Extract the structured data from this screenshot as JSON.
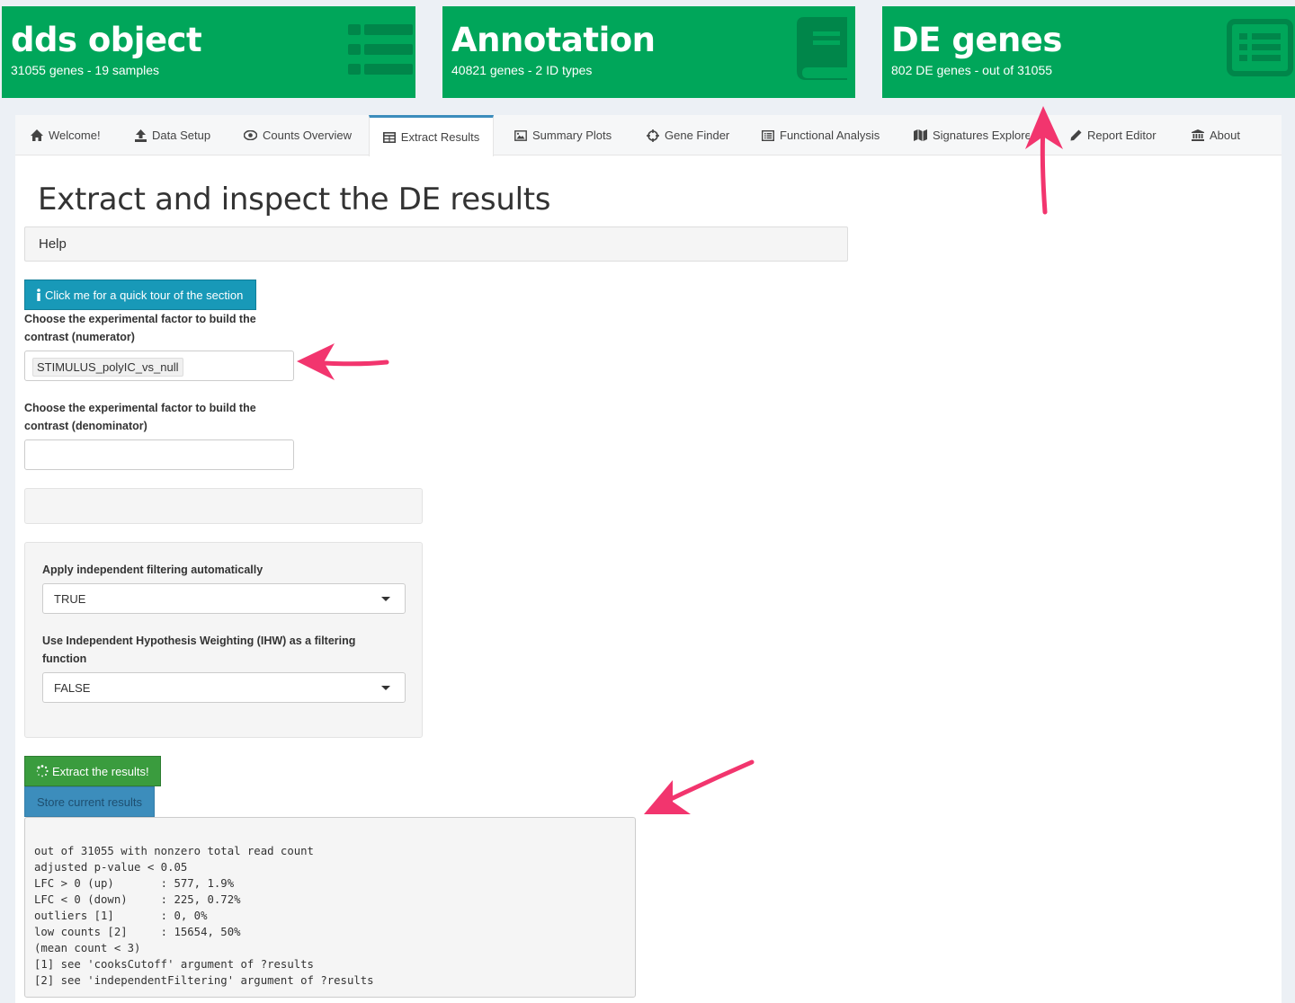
{
  "value_boxes": [
    {
      "title": "dds object",
      "subtitle": "31055 genes - 19 samples",
      "icon": "list-icon"
    },
    {
      "title": "Annotation",
      "subtitle": "40821 genes - 2 ID types",
      "icon": "book-icon"
    },
    {
      "title": "DE genes",
      "subtitle": "802 DE genes - out of 31055",
      "icon": "list-alt-icon"
    }
  ],
  "tabs": [
    {
      "label": "Welcome!",
      "icon": "home-icon"
    },
    {
      "label": "Data Setup",
      "icon": "upload-icon"
    },
    {
      "label": "Counts Overview",
      "icon": "eye-icon"
    },
    {
      "label": "Extract Results",
      "icon": "table-icon",
      "active": true
    },
    {
      "label": "Summary Plots",
      "icon": "image-icon"
    },
    {
      "label": "Gene Finder",
      "icon": "crosshairs-icon"
    },
    {
      "label": "Functional Analysis",
      "icon": "list-alt-icon"
    },
    {
      "label": "Signatures Explorer",
      "icon": "map-icon"
    },
    {
      "label": "Report Editor",
      "icon": "pencil-icon"
    },
    {
      "label": "About",
      "icon": "institution-icon"
    }
  ],
  "main": {
    "heading": "Extract and inspect the DE results",
    "help_label": "Help",
    "tour_button": "Click me for a quick tour of the section",
    "numerator_label": "Choose the experimental factor to build the contrast (numerator)",
    "numerator_value": "STIMULUS_polyIC_vs_null",
    "denominator_label": "Choose the experimental factor to build the contrast (denominator)",
    "denominator_value": "",
    "indep_filter_label": "Apply independent filtering automatically",
    "indep_filter_value": "TRUE",
    "ihw_label": "Use Independent Hypothesis Weighting (IHW) as a filtering function",
    "ihw_value": "FALSE",
    "extract_button": "Extract the results!",
    "store_button": "Store current results",
    "results_summary": "out of 31055 with nonzero total read count\nadjusted p-value < 0.05\nLFC > 0 (up)       : 577, 1.9%\nLFC < 0 (down)     : 225, 0.72%\noutliers [1]       : 0, 0%\nlow counts [2]     : 15654, 50%\n(mean count < 3)\n[1] see 'cooksCutoff' argument of ?results\n[2] see 'independentFiltering' argument of ?results"
  },
  "colors": {
    "value_box_green": "#00a65a",
    "tab_active_border": "#3c8dbc",
    "tour_button": "#1899b8",
    "extract_button": "#3a9c3e",
    "store_button": "#3c8dbc",
    "annotation_arrow": "#f2356e"
  }
}
